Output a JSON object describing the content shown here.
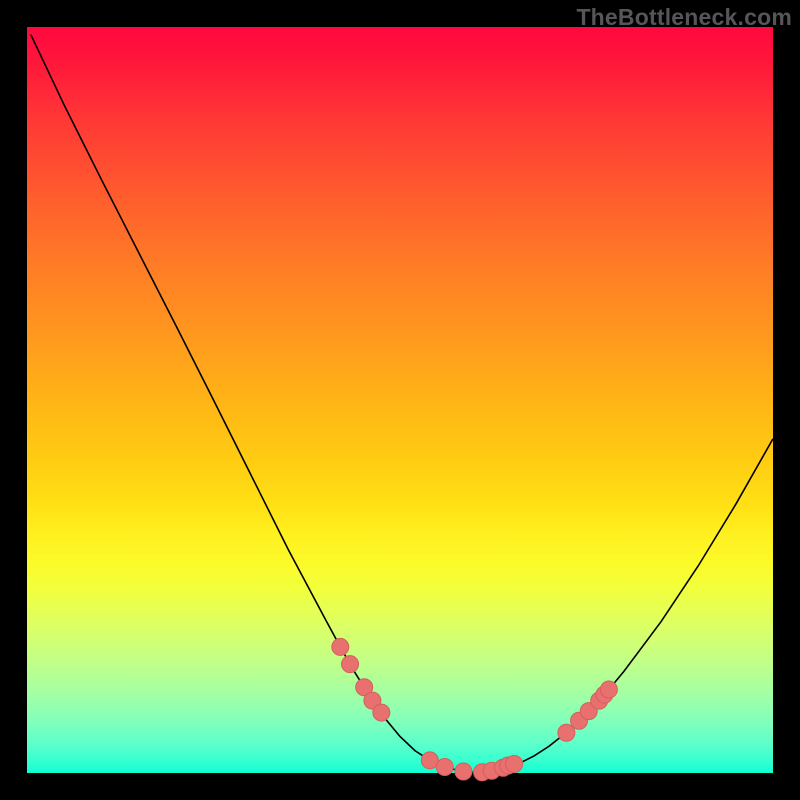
{
  "watermark": "TheBottleneck.com",
  "colors": {
    "curve": "#000000",
    "dot_fill": "#e8716f",
    "dot_stroke": "#d45f5d",
    "background": "#000000"
  },
  "chart_data": {
    "type": "line",
    "title": "",
    "xlabel": "",
    "ylabel": "",
    "xlim": [
      0,
      100
    ],
    "ylim": [
      0,
      100
    ],
    "grid": false,
    "legend": false,
    "series": [
      {
        "name": "bottleneck-curve",
        "x": [
          0.5,
          5,
          10,
          15,
          20,
          25,
          30,
          35,
          40,
          42,
          44,
          46,
          48,
          50,
          52,
          54,
          56,
          58,
          60,
          62,
          64,
          66,
          68,
          70,
          72,
          74,
          76,
          78,
          80,
          85,
          90,
          95,
          100
        ],
        "y": [
          99,
          89.5,
          79.5,
          69.7,
          59.9,
          50.0,
          40.0,
          30.0,
          20.6,
          16.9,
          13.4,
          10.2,
          7.3,
          4.9,
          3.0,
          1.7,
          0.8,
          0.3,
          0.1,
          0.2,
          0.6,
          1.3,
          2.3,
          3.6,
          5.2,
          7.0,
          9.0,
          11.2,
          13.6,
          20.3,
          27.8,
          36.0,
          44.8
        ]
      }
    ],
    "markers": {
      "name": "highlight-dots",
      "x": [
        42.0,
        43.3,
        45.2,
        46.3,
        47.5,
        54.0,
        56.0,
        58.5,
        61.0,
        62.3,
        63.8,
        64.5,
        65.3,
        72.3,
        74.0,
        75.3,
        76.7,
        77.4,
        78.0
      ],
      "y": [
        16.9,
        14.6,
        11.5,
        9.7,
        8.1,
        1.7,
        0.8,
        0.2,
        0.1,
        0.3,
        0.7,
        1.0,
        1.2,
        5.4,
        7.0,
        8.3,
        9.7,
        10.5,
        11.2
      ]
    }
  }
}
